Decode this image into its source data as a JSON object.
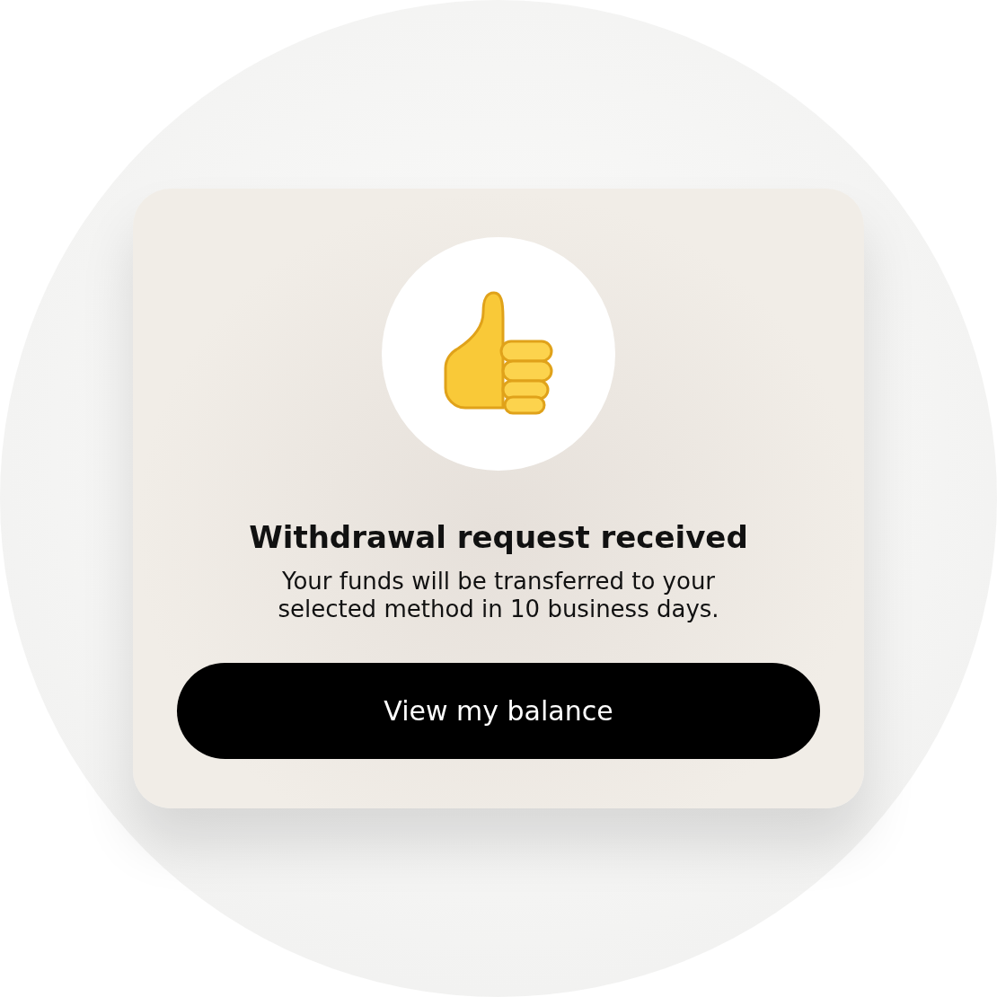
{
  "card": {
    "title": "Withdrawal request received",
    "message": "Your funds will be transferred to your selected method in 10 business days.",
    "button": "View my balance"
  }
}
